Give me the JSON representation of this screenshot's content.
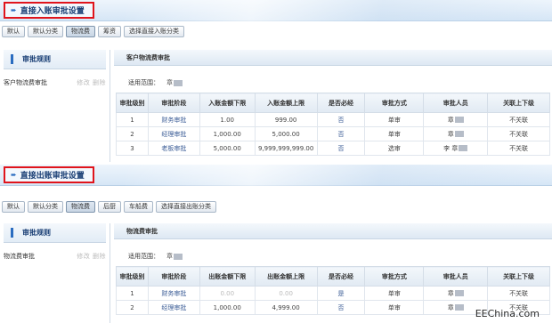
{
  "section1": {
    "title": "直接入账审批设置",
    "toolbar": [
      "默认",
      "默认分类",
      "物流费",
      "筹资",
      "选择直接入账分类"
    ],
    "active_tab": 2,
    "rules_heading": "审批规则",
    "rule_item": "客户物流费审批",
    "rule_ops": "修改 删除",
    "panel_title": "客户物流费审批",
    "scope_label": "适用范围：",
    "scope_value": "章",
    "columns": [
      "审批级别",
      "审批阶段",
      "入账金额下限",
      "入账金额上限",
      "是否必经",
      "审批方式",
      "审批人员",
      "关联上下级"
    ],
    "rows": [
      [
        "1",
        "财务审批",
        "1.00",
        "999.00",
        "否",
        "单审",
        "章",
        "不关联"
      ],
      [
        "2",
        "经理审批",
        "1,000.00",
        "5,000.00",
        "否",
        "单审",
        "章",
        "不关联"
      ],
      [
        "3",
        "老板审批",
        "5,000.00",
        "9,999,999,999.00",
        "否",
        "选审",
        "李  章",
        "不关联"
      ]
    ]
  },
  "section2": {
    "title": "直接出账审批设置",
    "toolbar": [
      "默认",
      "默认分类",
      "物流费",
      "后厨",
      "车船费",
      "选择直接出账分类"
    ],
    "active_tab": 2,
    "rules_heading": "审批规则",
    "rule_item": "物流费审批",
    "rule_ops": "修改 删除",
    "panel_title": "物流费审批",
    "scope_label": "适用范围：",
    "scope_value": "章",
    "columns": [
      "审批级别",
      "审批阶段",
      "出账金额下限",
      "出账金额上限",
      "是否必经",
      "审批方式",
      "审批人员",
      "关联上下级"
    ],
    "rows": [
      [
        "1",
        "财务审批",
        "0.00",
        "0.00",
        "是",
        "单审",
        "章",
        "不关联"
      ],
      [
        "2",
        "经理审批",
        "1,000.00",
        "4,999.00",
        "否",
        "单审",
        "章",
        "不关联"
      ]
    ]
  },
  "watermark": "EEChina.com",
  "colors": {
    "title_border": "#e0141c",
    "title_text": "#1a3f75",
    "link": "#3b5c96"
  }
}
